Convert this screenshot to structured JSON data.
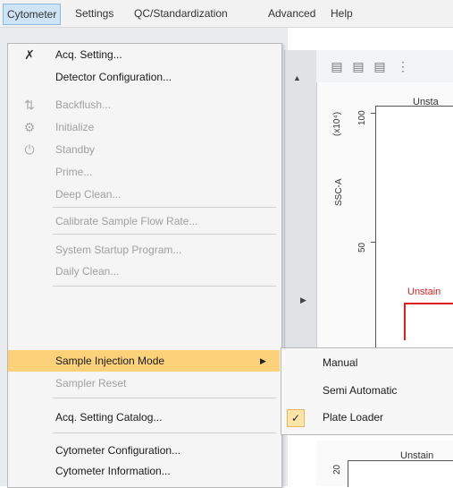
{
  "menubar": {
    "items": [
      {
        "label": "Cytometer",
        "active": true
      },
      {
        "label": "Settings"
      },
      {
        "label": "QC/Standardization"
      },
      {
        "label": "Advanced"
      },
      {
        "label": "Help"
      }
    ]
  },
  "menu": {
    "items": [
      {
        "label": "Acq. Setting...",
        "icon": "pin-icon",
        "enabled": true
      },
      {
        "label": "Detector Configuration...",
        "enabled": true
      },
      {
        "label": "Backflush...",
        "icon": "backflush-icon",
        "enabled": false
      },
      {
        "label": "Initialize",
        "icon": "gear-icon",
        "enabled": false
      },
      {
        "label": "Standby",
        "icon": "power-icon",
        "enabled": false
      },
      {
        "label": "Prime...",
        "enabled": false
      },
      {
        "label": "Deep Clean...",
        "enabled": false
      },
      {
        "label": "Calibrate Sample Flow Rate...",
        "enabled": false
      },
      {
        "label": "System Startup Program...",
        "enabled": false
      },
      {
        "label": "Daily Clean...",
        "enabled": false
      },
      {
        "label": "Sample Injection Mode",
        "enabled": true,
        "highlighted": true,
        "has_submenu": true
      },
      {
        "label": "Sampler Reset",
        "enabled": false
      },
      {
        "label": "Acq. Setting Catalog...",
        "enabled": true
      },
      {
        "label": "Cytometer Configuration...",
        "enabled": true
      },
      {
        "label": "Cytometer Information...",
        "enabled": true
      }
    ]
  },
  "submenu": {
    "items": [
      {
        "label": "Manual",
        "checked": false
      },
      {
        "label": "Semi Automatic",
        "checked": false
      },
      {
        "label": "Plate Loader",
        "checked": true
      }
    ]
  },
  "plot": {
    "title": "Unsta",
    "y_multiplier": "(x10⁴)",
    "y_label": "SSC-A",
    "tick_100": "100",
    "tick_50": "50",
    "gate_label": "Unstain",
    "plot2_title": "Unstain",
    "plot2_tick": "20"
  },
  "colors": {
    "highlight": "#fbd27a",
    "menubar_active": "#cfe4f7",
    "gate": "#e02020",
    "check_bg": "#fde4a8"
  }
}
